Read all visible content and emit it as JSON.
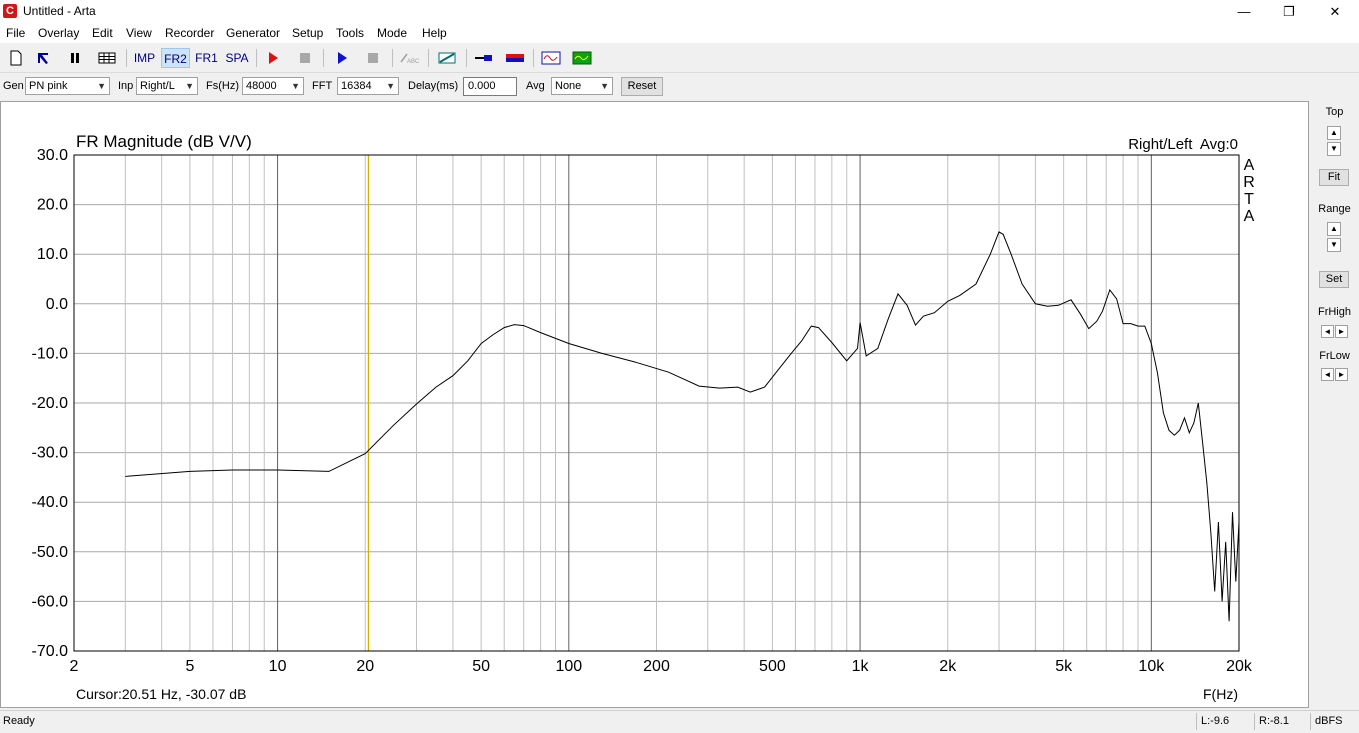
{
  "window": {
    "title": "Untitled - Arta",
    "app_icon_letter": "C",
    "minimize": "—",
    "maximize": "❐",
    "close": "✕"
  },
  "menu": [
    "File",
    "Overlay",
    "Edit",
    "View",
    "Recorder",
    "Generator",
    "Setup",
    "Tools",
    "Mode",
    "Help"
  ],
  "toolbar": {
    "imp": "IMP",
    "fr2": "FR2",
    "fr1": "FR1",
    "spa": "SPA",
    "abc": "ABC"
  },
  "params": {
    "gen_label": "Gen",
    "gen_value": "PN pink",
    "inp_label": "Inp",
    "inp_value": "Right/L",
    "fs_label": "Fs(Hz)",
    "fs_value": "48000",
    "fft_label": "FFT",
    "fft_value": "16384",
    "delay_label": "Delay(ms)",
    "delay_value": "0.000",
    "avg_label": "Avg",
    "avg_value": "None",
    "reset_label": "Reset"
  },
  "right_panel": {
    "top_label": "Top",
    "fit_label": "Fit",
    "range_label": "Range",
    "set_label": "Set",
    "frhigh_label": "FrHigh",
    "frlow_label": "FrLow"
  },
  "status": {
    "ready": "Ready",
    "left_level": "L:-9.6",
    "right_level": "R:-8.1",
    "units": "dBFS"
  },
  "chart_data": {
    "type": "line",
    "title": "FR Magnitude (dB V/V)",
    "channel_label": "Right/Left  Avg:0",
    "watermark": "ARTA",
    "xlabel": "F(Hz)",
    "x_scale": "log",
    "xlim": [
      2,
      20000
    ],
    "ylim": [
      -70,
      30
    ],
    "y_ticks": [
      30,
      20,
      10,
      0,
      -10,
      -20,
      -30,
      -40,
      -50,
      -60,
      -70
    ],
    "y_tick_labels": [
      "30.0",
      "20.0",
      "10.0",
      "0.0",
      "-10.0",
      "-20.0",
      "-30.0",
      "-40.0",
      "-50.0",
      "-60.0",
      "-70.0"
    ],
    "x_ticks": [
      2,
      5,
      10,
      20,
      50,
      100,
      200,
      500,
      1000,
      2000,
      5000,
      10000,
      20000
    ],
    "x_tick_labels": [
      "2",
      "5",
      "10",
      "20",
      "50",
      "100",
      "200",
      "500",
      "1k",
      "2k",
      "5k",
      "10k",
      "20k"
    ],
    "grid": true,
    "cursor": {
      "freq": 20.51,
      "db": -30.07,
      "label": "Cursor:20.51 Hz, -30.07 dB"
    },
    "series": [
      {
        "color": "#000000",
        "x": [
          3,
          5,
          7,
          10,
          15,
          20,
          25,
          30,
          35,
          40,
          45,
          50,
          55,
          60,
          65,
          70,
          80,
          100,
          130,
          170,
          220,
          280,
          330,
          380,
          420,
          470,
          520,
          580,
          630,
          680,
          720,
          800,
          900,
          980,
          1000,
          1050,
          1150,
          1250,
          1350,
          1450,
          1550,
          1650,
          1800,
          2000,
          2200,
          2500,
          2800,
          3000,
          3100,
          3300,
          3600,
          4000,
          4400,
          4800,
          5300,
          5700,
          6100,
          6500,
          6800,
          7200,
          7600,
          8000,
          8500,
          9000,
          9500,
          10000,
          10500,
          11000,
          11500,
          12000,
          12500,
          13000,
          13500,
          14000,
          14500,
          15000,
          15500,
          16000,
          16500,
          17000,
          17500,
          18000,
          18500,
          19000,
          19500,
          20000
        ],
        "y": [
          -34.8,
          -33.8,
          -33.5,
          -33.5,
          -33.8,
          -30.2,
          -24.5,
          -20.2,
          -16.8,
          -14.5,
          -11.5,
          -8.0,
          -6.2,
          -4.8,
          -4.2,
          -4.4,
          -5.8,
          -8.0,
          -10.0,
          -11.8,
          -13.8,
          -16.6,
          -17.0,
          -16.8,
          -17.8,
          -16.8,
          -13.5,
          -10.0,
          -7.5,
          -4.5,
          -4.8,
          -7.8,
          -11.5,
          -9.0,
          -3.8,
          -10.5,
          -9.0,
          -3.0,
          2.0,
          -0.3,
          -4.3,
          -2.5,
          -1.8,
          0.5,
          1.7,
          4.0,
          10.0,
          14.5,
          14.0,
          10.0,
          4.0,
          0.0,
          -0.5,
          -0.3,
          0.8,
          -2.0,
          -5.0,
          -3.5,
          -1.5,
          2.8,
          1.0,
          -4.0,
          -4.0,
          -4.5,
          -4.5,
          -8.0,
          -14.0,
          -22.0,
          -25.5,
          -26.5,
          -25.5,
          -23.0,
          -26.0,
          -24.0,
          -20.0,
          -28.0,
          -36.0,
          -46.0,
          -58.0,
          -44.0,
          -60.0,
          -48.0,
          -64.0,
          -42.0,
          -56.0,
          -44.0
        ]
      }
    ]
  }
}
